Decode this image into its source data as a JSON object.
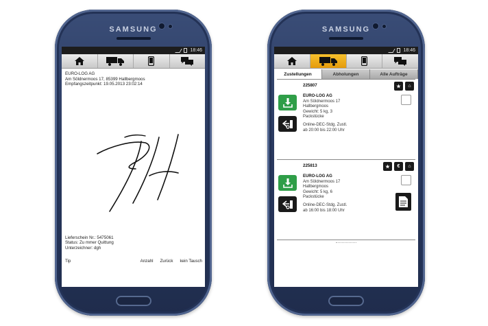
{
  "device": {
    "brand": "SAMSUNG"
  },
  "status_bar": {
    "time": "18:46"
  },
  "nav": {
    "items": [
      {
        "icon": "home-icon"
      },
      {
        "icon": "truck-icon"
      },
      {
        "icon": "phone-icon"
      },
      {
        "icon": "chat-icon"
      }
    ]
  },
  "signature_screen": {
    "company": "EURO-LOG AG",
    "address": "Am Söldnermoos 17, 85399 Hallbergmoos",
    "received": "Empfangszeitpunkt: 19.05.2013 23:02:14",
    "delivery_note": "Lieferschein Nr.: 5475061",
    "status": "Status: Zu       mmer Quittung",
    "signer": "Unterzeichner: dgh",
    "actions": {
      "left": "Tip",
      "a": "Anzahl",
      "b": "Zurück",
      "c": "kein Tausch"
    }
  },
  "list_screen": {
    "tabs": [
      {
        "label": "Zustellungen",
        "active": true
      },
      {
        "label": "Abholungen",
        "active": false
      },
      {
        "label": "Alle Aufträge",
        "active": false
      }
    ],
    "orders": [
      {
        "number": "225807",
        "name": "EURO-LOG AG",
        "street": "Am Söldnermoos 17",
        "city": "Hallbergmoos",
        "weight": "Gewicht: 5 kg, 3",
        "pieces": "Packstücke",
        "service": "Online-DEC-Stdg. Zustl.",
        "window": "ab 20:00 bis 22:00 Uhr",
        "actions": [
          "★",
          "⌂"
        ]
      },
      {
        "number": "225813",
        "name": "EURO-LOG AG",
        "street": "Am Söldnermoos 17",
        "city": "Hallbergmoos",
        "weight": "Gewicht: 5 kg, 6",
        "pieces": "Packstücke",
        "service": "Online-DEC-Stdg. Zustl.",
        "window": "ab 16:00 bis 18:00 Uhr",
        "actions": [
          "★",
          "€",
          "⌂"
        ]
      }
    ]
  }
}
